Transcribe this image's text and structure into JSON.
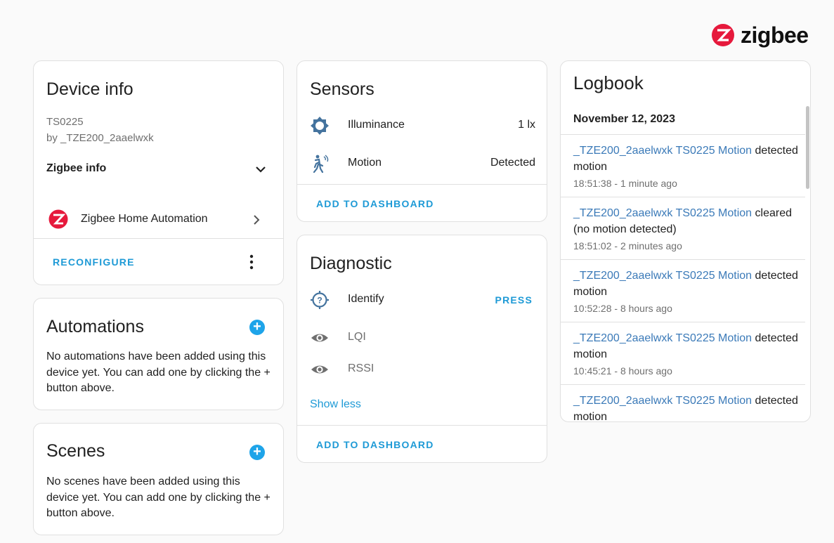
{
  "brand": {
    "logo_text": "zigbee",
    "accent": "#e6193c"
  },
  "device_info": {
    "title": "Device info",
    "model": "TS0225",
    "manufacturer": "by _TZE200_2aaelwxk",
    "zigbee_info_label": "Zigbee info",
    "integration_label": "Zigbee Home Automation",
    "reconfigure_label": "RECONFIGURE"
  },
  "automations": {
    "title": "Automations",
    "empty_text": "No automations have been added using this device yet. You can add one by clicking the + button above."
  },
  "scenes": {
    "title": "Scenes",
    "empty_text": "No scenes have been added using this device yet. You can add one by clicking the + button above."
  },
  "sensors": {
    "title": "Sensors",
    "items": [
      {
        "name": "Illuminance",
        "value": "1 lx",
        "icon": "brightness-icon"
      },
      {
        "name": "Motion",
        "value": "Detected",
        "icon": "motion-sensor-icon"
      }
    ],
    "add_label": "ADD TO DASHBOARD"
  },
  "diagnostic": {
    "title": "Diagnostic",
    "identify": {
      "name": "Identify",
      "action": "PRESS"
    },
    "items": [
      {
        "name": "LQI",
        "icon": "eye-icon"
      },
      {
        "name": "RSSI",
        "icon": "eye-icon"
      }
    ],
    "show_less": "Show less",
    "add_label": "ADD TO DASHBOARD"
  },
  "logbook": {
    "title": "Logbook",
    "date": "November 12, 2023",
    "entries": [
      {
        "entity": "_TZE200_2aaelwxk TS0225 Motion",
        "message": " detected motion",
        "time": "18:51:38 - 1 minute ago"
      },
      {
        "entity": "_TZE200_2aaelwxk TS0225 Motion",
        "message": " cleared (no motion detected)",
        "time": "18:51:02 - 2 minutes ago"
      },
      {
        "entity": "_TZE200_2aaelwxk TS0225 Motion",
        "message": " detected motion",
        "time": "10:52:28 - 8 hours ago"
      },
      {
        "entity": "_TZE200_2aaelwxk TS0225 Motion",
        "message": " detected motion",
        "time": "10:45:21 - 8 hours ago"
      },
      {
        "entity": "_TZE200_2aaelwxk TS0225 Motion",
        "message": " detected motion",
        "time": ""
      }
    ]
  }
}
